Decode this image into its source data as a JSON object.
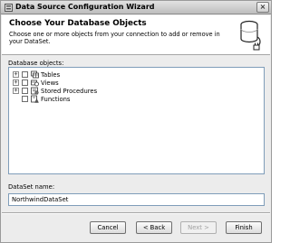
{
  "window": {
    "title": "Data Source Configuration Wizard",
    "close_glyph": "×"
  },
  "header": {
    "title": "Choose Your Database Objects",
    "description": "Choose one or more objects from your connection to add or remove in your DataSet."
  },
  "objects": {
    "label": "Database objects:",
    "items": [
      {
        "label": "Tables",
        "icon": "tables-icon",
        "expandable": true,
        "checked": false,
        "expander": "+"
      },
      {
        "label": "Views",
        "icon": "views-icon",
        "expandable": true,
        "checked": false,
        "expander": "+"
      },
      {
        "label": "Stored Procedures",
        "icon": "stored-procedures-icon",
        "expandable": true,
        "checked": false,
        "expander": "+"
      },
      {
        "label": "Functions",
        "icon": "functions-icon",
        "expandable": false,
        "checked": false,
        "expander": ""
      }
    ]
  },
  "dataset": {
    "label": "DataSet name:",
    "value": "NorthwindDataSet"
  },
  "buttons": {
    "cancel": "Cancel",
    "back": "< Back",
    "next": "Next >",
    "finish": "Finish"
  }
}
